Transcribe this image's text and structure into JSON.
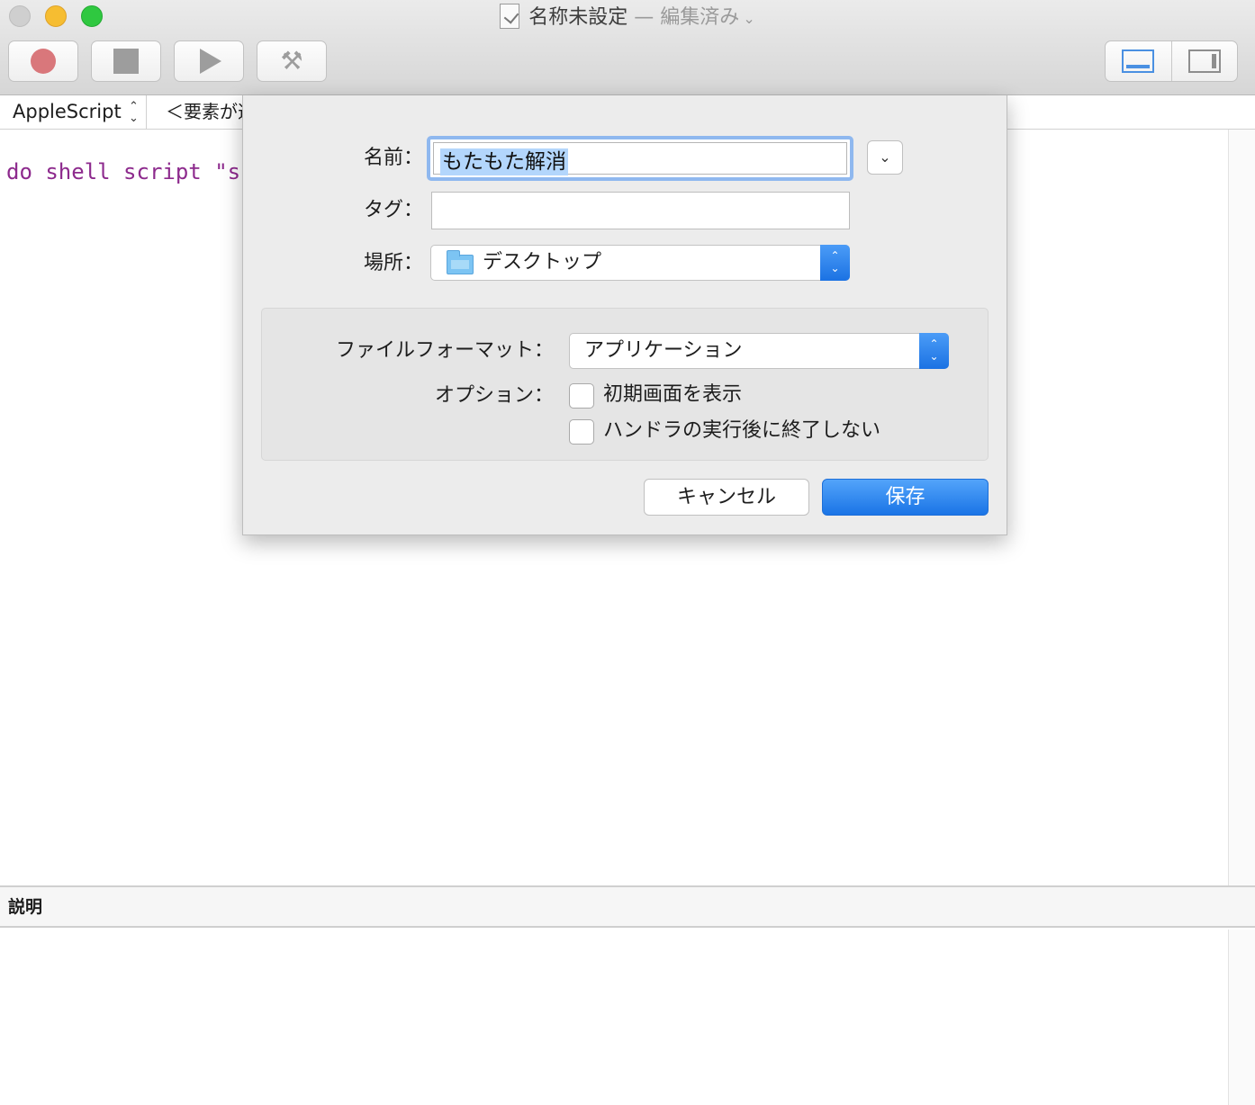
{
  "window": {
    "title": "名称未設定",
    "title_separator": "—",
    "title_status": "編集済み",
    "title_chevron": "⌄"
  },
  "toolbar": {
    "record_icon": "record-icon",
    "stop_icon": "stop-icon",
    "run_icon": "play-icon",
    "compile_icon": "hammer-icon",
    "hammer_glyph": "⚒"
  },
  "navbar": {
    "language": "AppleScript",
    "language_arrows": "⌃\n⌄",
    "element": "＜要素が選択されていません＞"
  },
  "editor": {
    "code": "do shell script \"su"
  },
  "description": {
    "header": "説明"
  },
  "save_sheet": {
    "name_label": "名前：",
    "name_value": "もたもた解消",
    "expand_glyph": "⌄",
    "tags_label": "タグ：",
    "tags_value": "",
    "location_label": "場所：",
    "location_value": "デスクトップ",
    "arrows": "⌃\n⌄",
    "format_label": "ファイルフォーマット：",
    "format_value": "アプリケーション",
    "options_label": "オプション：",
    "option_1": "初期画面を表示",
    "option_2": "ハンドラの実行後に終了しない",
    "option_1_checked": false,
    "option_2_checked": false,
    "cancel_label": "キャンセル",
    "save_label": "保存"
  },
  "colors": {
    "accent": "#1b72e3",
    "selection": "#b3d6fc",
    "code_keyword": "#8d2a8d",
    "record": "#d9777b"
  }
}
